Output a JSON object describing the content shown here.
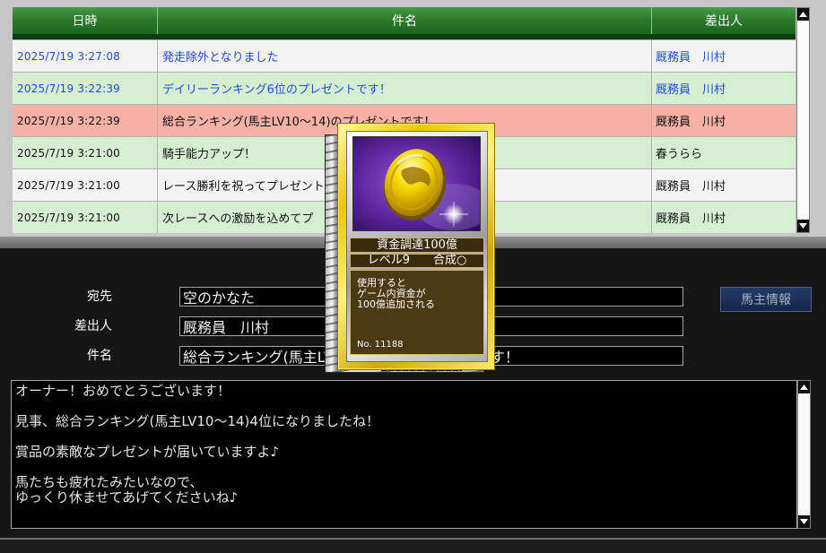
{
  "inbox": {
    "columns": {
      "date": "日時",
      "subject": "件名",
      "sender": "差出人"
    },
    "rows": [
      {
        "date": "2025/7/19 3:27:08",
        "subject": "発走除外となりました",
        "sender": "厩務員　川村",
        "unread": true,
        "selected": false
      },
      {
        "date": "2025/7/19 3:22:39",
        "subject": "デイリーランキング6位のプレゼントです！",
        "sender": "厩務員　川村",
        "unread": true,
        "selected": false
      },
      {
        "date": "2025/7/19 3:22:39",
        "subject": "総合ランキング(馬主LV10～14)のプレゼントです！",
        "sender": "厩務員　川村",
        "unread": false,
        "selected": true
      },
      {
        "date": "2025/7/19 3:21:00",
        "subject": "騎手能力アップ！",
        "sender": "春うらら",
        "unread": false,
        "selected": false
      },
      {
        "date": "2025/7/19 3:21:00",
        "subject": "レース勝利を祝ってプレゼント",
        "sender": "厩務員　川村",
        "unread": false,
        "selected": false
      },
      {
        "date": "2025/7/19 3:21:00",
        "subject": "次レースへの激励を込めてプ",
        "sender": "厩務員　川村",
        "unread": false,
        "selected": false
      }
    ]
  },
  "card": {
    "name": "資金調達100億",
    "level": "レベル9",
    "fusion": "合成○",
    "description": [
      "使用すると",
      "ゲーム内資金が",
      "100億追加される"
    ],
    "number": "No. 11188"
  },
  "message": {
    "fields": {
      "to": {
        "label": "宛先",
        "value": "空のかなた"
      },
      "from": {
        "label": "差出人",
        "value": "厩務員　川村"
      },
      "subject": {
        "label": "件名",
        "value": "総合ランキング(馬主LV10～14)のプレゼントです！"
      }
    },
    "owner_info_button": "馬主情報",
    "body": [
      "オーナー！おめでとうございます！",
      "見事、総合ランキング(馬主LV10～14)4位になりましたね！",
      "賞品の素敵なプレゼントが届いていますよ♪",
      "馬たちも疲れたみたいなので、",
      "ゆっくり休ませてあげてくださいね♪"
    ]
  },
  "icons": {
    "card_art": "gold-coin-icon",
    "scroll_up": "arrow-up-icon",
    "scroll_down": "arrow-down-icon"
  },
  "colors": {
    "header_bg": "#2b7b2b",
    "unread_text": "#1f4fd1",
    "read_text": "#111111",
    "row_bg": "#f3f3f3",
    "row_alt_bg": "#d6efd2",
    "selected_bg": "#f7b1a5",
    "card_frame": "#e9c800",
    "owner_button_bg": "#1c3058"
  }
}
